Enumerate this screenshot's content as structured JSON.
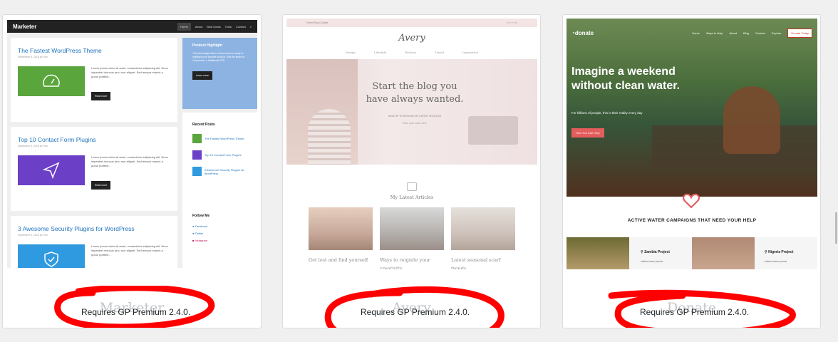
{
  "themes": [
    {
      "name": "Marketer",
      "requirement": "Requires GP Premium 2.4.0.",
      "preview": {
        "logo": "Marketer",
        "menu": [
          "Home",
          "About",
          "Best Deals",
          "Tools",
          "Contact"
        ],
        "posts": [
          {
            "title": "The Fastest WordPress Theme",
            "meta": "September 6, 2018 by Tom",
            "color": "#5ba53d",
            "excerpt": "Lorem ipsum dolor sit amet, consectetur adipiscing elit. Nunc imperdiet rhoncus arcu non aliquet. Sed tempor mauris a purus porttitor...",
            "button": "Read more"
          },
          {
            "title": "Top 10 Contact Form Plugins",
            "meta": "September 6, 2018 by Tom",
            "color": "#6b3fc6",
            "excerpt": "Lorem ipsum dolor sit amet, consectetur adipiscing elit. Nunc imperdiet rhoncus arcu non aliquet. Sed tempor mauris a purus porttitor...",
            "button": "Read more"
          },
          {
            "title": "3 Awesome Security Plugins for WordPress",
            "meta": "September 6, 2018 by Tom",
            "color": "#2f9ae0",
            "excerpt": "Lorem ipsum dolor sit amet, consectetur adipiscing elit. Nunc imperdiet rhoncus arcu non aliquet. Sed tempor mauris a purus porttitor...",
            "button": ""
          }
        ],
        "highlight": {
          "title": "Product Highlight",
          "text": "This text widget sits in a fixed column ready to highlight your favorite product. Edit the styles in Customizer > Additional CSS.",
          "button": "Learn more"
        },
        "recent_title": "Recent Posts",
        "recent": [
          "The Fastest WordPress Theme",
          "Top 10 Contact Form Plugins",
          "3 Awesome Security Plugins for WordPress"
        ],
        "follow_title": "Follow Me",
        "follow": [
          "Facebook",
          "Twitter",
          "Instagram"
        ]
      }
    },
    {
      "name": "Avery",
      "requirement": "Requires GP Premium 2.4.0.",
      "preview": {
        "top_links": "Home  Blog  Contact",
        "top_social": "f  ◎  ✦  t  ◎",
        "logo": "Avery",
        "menu": [
          "Design",
          "Lifestyle",
          "Fashion",
          "Travel",
          "Inspiration"
        ],
        "hero_title": "Start the blog you have always wanted.",
        "hero_sub": "SIGN UP TO RECEIVE MY LATEST ARTICLES",
        "hero_input": "Enter your name here",
        "latest": "My Latest Articles",
        "articles": [
          "Get lost and find yourself",
          "Ways to reignite your creativity",
          "Latest seasonal scarf trends"
        ]
      }
    },
    {
      "name": "Donate",
      "requirement": "Requires GP Premium 2.4.0.",
      "preview": {
        "logo": "donate",
        "menu": [
          "Home",
          "Ways to Help",
          "About",
          "Blog",
          "Contact",
          "Explore"
        ],
        "menu_button": "Donate Today",
        "hero_title": "Imagine a weekend without clean water.",
        "hero_sub": "For billions of people, this is their reality every day",
        "hero_button": "How You Can Help",
        "campaigns_title": "ACTIVE WATER CAMPAIGNS THAT NEED YOUR HELP",
        "projects": [
          {
            "name": "Zambia Project",
            "text": "sotium lorem proma"
          },
          {
            "name": "Nigeria Project",
            "text": "sotium lorem proma"
          }
        ]
      }
    }
  ],
  "colors": {
    "annotation": "#ff0000",
    "card_border": "#dcdcde",
    "background": "#f0f0f1"
  }
}
